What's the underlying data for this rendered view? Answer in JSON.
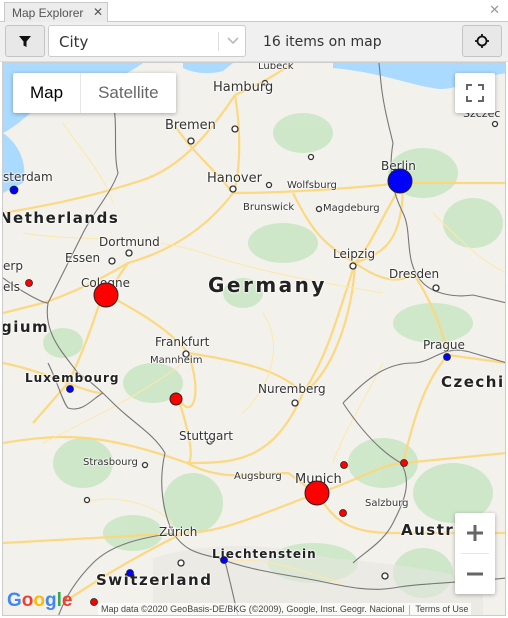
{
  "window": {
    "tab_title": "Map Explorer",
    "tab_close_icon": "close-icon",
    "panel_close_icon": "close-icon"
  },
  "toolbar": {
    "filter_icon": "filter-funnel-icon",
    "select_value": "City",
    "select_chevron_icon": "chevron-down-icon",
    "items_count": "16 items on map",
    "locate_icon": "crosshair-icon"
  },
  "map": {
    "map_type": {
      "map_label": "Map",
      "satellite_label": "Satellite",
      "selected": "Map"
    },
    "fullscreen_icon": "fullscreen-icon",
    "zoom_in_icon": "plus-icon",
    "zoom_out_icon": "minus-icon",
    "google_logo": "Google",
    "attribution": "Map data ©2020 GeoBasis-DE/BKG (©2009), Google, Inst. Geogr. Nacional",
    "terms_label": "Terms of Use",
    "labels": {
      "germany": "Germany",
      "netherlands": "Netherlands",
      "belgium": "gium",
      "luxembourg": "Luxembourg",
      "switzerland": "Switzerland",
      "czechia": "Czechi",
      "austria": "Austri",
      "liechtenstein": "Liechtenstein",
      "hamburg": "Hamburg",
      "lubeck": "Lübeck",
      "bremen": "Bremen",
      "szczecin": "Szczec",
      "amsterdam": "sterdam",
      "berlin": "Berlin",
      "hanover": "Hanover",
      "wolfsburg": "Wolfsburg",
      "brunswick": "Brunswick",
      "magdeburg": "Magdeburg",
      "dortmund": "Dortmund",
      "essen": "Essen",
      "antwerp": "erp",
      "brussels": "els",
      "cologne": "Cologne",
      "leipzig": "Leipzig",
      "dresden": "Dresden",
      "frankfurt": "Frankfurt",
      "prague": "Prague",
      "mannheim": "Mannheim",
      "nuremberg": "Nuremberg",
      "stuttgart": "Stuttgart",
      "strasbourg": "Strasbourg",
      "augsburg": "Augsburg",
      "munich": "Munich",
      "salzburg": "Salzburg",
      "zurich": "Zürich"
    },
    "markers": [
      {
        "name": "Berlin",
        "color": "#0000ff",
        "size": "large"
      },
      {
        "name": "Cologne",
        "color": "#ff0000",
        "size": "large"
      },
      {
        "name": "Munich",
        "color": "#ff0000",
        "size": "large"
      },
      {
        "name": "Mannheim",
        "color": "#ff0000",
        "size": "medium"
      },
      {
        "name": "Amsterdam",
        "color": "#0000ff",
        "size": "small"
      },
      {
        "name": "Brussels",
        "color": "#ff0000",
        "size": "small"
      },
      {
        "name": "Luxembourg",
        "color": "#0000ff",
        "size": "small"
      },
      {
        "name": "Prague",
        "color": "#0000ff",
        "size": "small"
      },
      {
        "name": "Landshut",
        "color": "#ff0000",
        "size": "small"
      },
      {
        "name": "Passau",
        "color": "#ff0000",
        "size": "small"
      },
      {
        "name": "Rosenheim",
        "color": "#ff0000",
        "size": "small"
      },
      {
        "name": "Vaduz",
        "color": "#0000ff",
        "size": "small"
      },
      {
        "name": "Bern",
        "color": "#0000ff",
        "size": "small"
      },
      {
        "name": "Geneva",
        "color": "#ff0000",
        "size": "small"
      }
    ]
  }
}
